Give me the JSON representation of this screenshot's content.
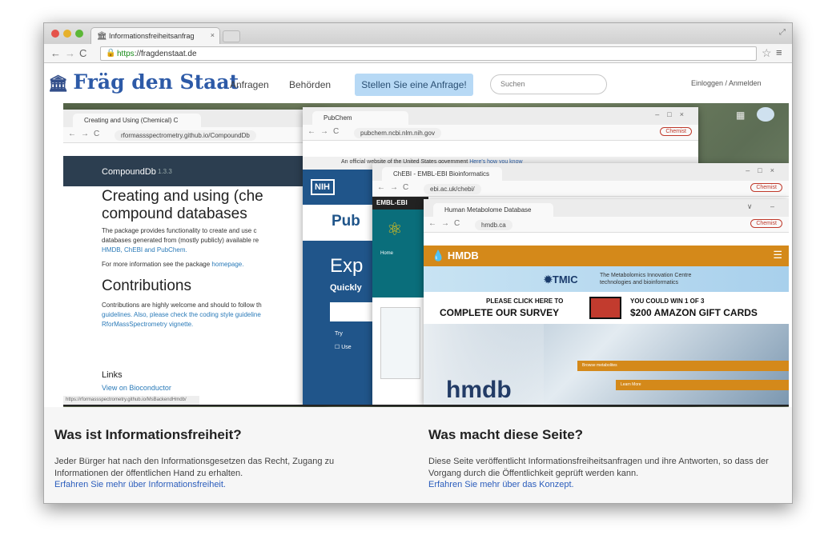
{
  "browser": {
    "tab_title": "Informationsfreiheitsanfrag",
    "tab_close": "×",
    "url_scheme": "https",
    "url_rest": "://fragdenstaat.de"
  },
  "site": {
    "logo": "Fräg den Staat",
    "nav": [
      "Anfragen",
      "Behörden"
    ],
    "cta": "Stellen Sie eine Anfrage!",
    "search_placeholder": "Suchen",
    "login": "Einloggen / Anmelden"
  },
  "shots": {
    "compounddb": {
      "tab": "Creating and Using (Chemical) C",
      "url": "rformassspectrometry.github.io/CompoundDb",
      "header": "CompoundDb",
      "version": "1.3.3",
      "title1": "Creating and using (che",
      "title2": "compound databases",
      "text1": "The package provides functionality to create and use c",
      "text2": "databases generated from (mostly publicly) available re",
      "links1": "HMDB, ChEBI and PubChem.",
      "text3": "For more information see the package",
      "homepage": "homepage.",
      "h_contrib": "Contributions",
      "text4": "Contributions are highly welcome and should to follow th",
      "text5": "guidelines. Also, please check the coding style guideline",
      "text6": "RforMassSpectrometry vignette.",
      "links_h": "Links",
      "bioc": "View on Bioconductor",
      "status": "https://rformassspectrometry.github.io/MsBackendHmdb/"
    },
    "pubchem": {
      "tab": "PubChem",
      "url": "pubchem.ncbi.nlm.nih.gov",
      "gov": "An official website of the United States government",
      "gov_link": "Here's how you know",
      "nih": "NIH",
      "pub": "Pub",
      "exp": "Exp",
      "quick": "Quickly",
      "try": "Try",
      "use": "Use"
    },
    "chebi": {
      "tab": "ChEBI - EMBL-EBI Bioinformatics",
      "url": "ebi.ac.uk/chebi/",
      "ebi": "EMBL-EBI",
      "home": "Home"
    },
    "hmdb": {
      "tab": "Human Metabolome Database",
      "url": "hmdb.ca",
      "brand": "HMDB",
      "tmic": "TMIC",
      "tmic_text1": "The Metabolomics Innovation Centre",
      "tmic_text2": "technologies and bioinformatics",
      "survey1": "PLEASE CLICK HERE TO",
      "survey2": "COMPLETE OUR SURVEY",
      "win1": "YOU COULD WIN 1 OF 3",
      "win2": "$200 AMAZON GIFT CARDS",
      "btn1": "Browse metabolites",
      "btn2": "Learn More",
      "logo": "hmdb"
    },
    "profile": "Chemist",
    "status_profile": "Chemist"
  },
  "info": {
    "left_h": "Was ist Informationsfreiheit?",
    "left_p": "Jeder Bürger hat nach den Informationsgesetzen das Recht, Zugang zu Informationen der öffentlichen Hand zu erhalten.",
    "left_link": "Erfahren Sie mehr über Informationsfreiheit.",
    "right_h": "Was macht diese Seite?",
    "right_p": "Diese Seite veröffentlicht Informationsfreiheitsanfragen und ihre Antworten, so dass der Vorgang durch die Öffentlichkeit geprüft werden kann.",
    "right_link": "Erfahren Sie mehr über das Konzept."
  },
  "colors": {
    "brand_blue": "#2d5aa7",
    "cta_bg": "#b7d9f5",
    "hmdb_orange": "#d4891a",
    "nih_blue": "#20558a",
    "ebi_teal": "#0a6e7b",
    "link": "#2b5dbc"
  }
}
